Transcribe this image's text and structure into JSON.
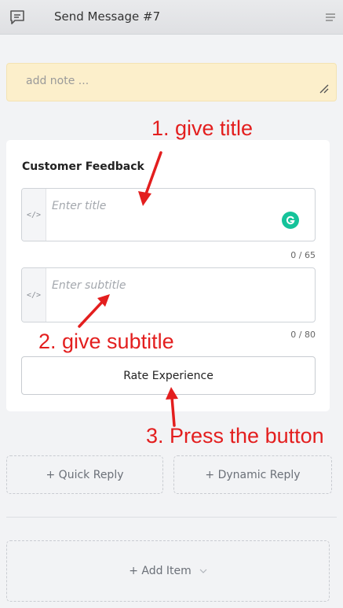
{
  "header": {
    "title": "Send Message #7",
    "message_icon": "message-square-icon",
    "menu_icon": "menu-icon"
  },
  "note": {
    "placeholder": "add note ..."
  },
  "card": {
    "title": "Customer Feedback",
    "title_field": {
      "placeholder": "Enter title",
      "value": "",
      "counter": "0 / 65",
      "code_icon": "</>"
    },
    "subtitle_field": {
      "placeholder": "Enter subtitle",
      "value": "",
      "counter": "0 / 80",
      "code_icon": "</>"
    },
    "button_label": "Rate Experience"
  },
  "quick_reply_label": "+ Quick Reply",
  "dynamic_reply_label": "+ Dynamic Reply",
  "add_item_label": "+ Add Item",
  "annotations": {
    "step1": "1. give title",
    "step2": "2. give subtitle",
    "step3": "3. Press the button",
    "color": "#e31e1e"
  },
  "colors": {
    "note_background": "#fcefcb",
    "grammarly": "#15c39a"
  }
}
